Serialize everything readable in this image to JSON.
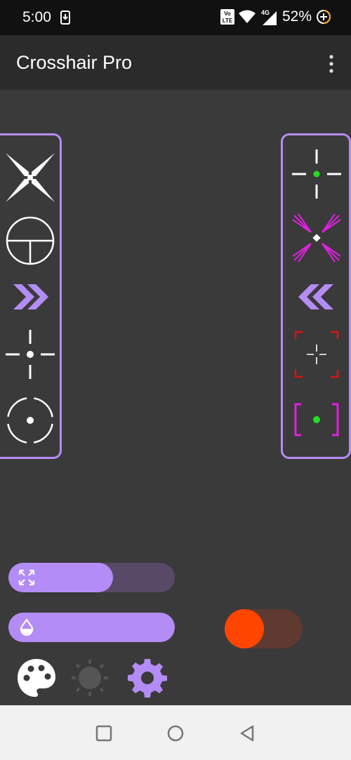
{
  "status_bar": {
    "time": "5:00",
    "battery_text": "52%",
    "network_text": "4G",
    "volte_text": "Vo LTE"
  },
  "app_bar": {
    "title": "Crosshair Pro"
  },
  "crosshair_panels": {
    "left": [
      "x-crosshair-icon",
      "scope-crosshair-icon",
      "chevron-right-double-icon",
      "cross-dot-crosshair-icon",
      "dashed-circle-crosshair-icon"
    ],
    "right": [
      "green-dot-cross-icon",
      "magenta-x-crosshair-icon",
      "chevron-left-double-icon",
      "red-brackets-crosshair-icon",
      "magenta-brackets-green-dot-icon"
    ],
    "accent": "#b48cf5"
  },
  "controls": {
    "size_slider_value": 0.63,
    "opacity_slider_value": 1.0,
    "toggle_on": true,
    "toggle_color": "#ff4500"
  },
  "toolbar": [
    "palette-icon",
    "brightness-icon",
    "settings-gear-icon"
  ]
}
